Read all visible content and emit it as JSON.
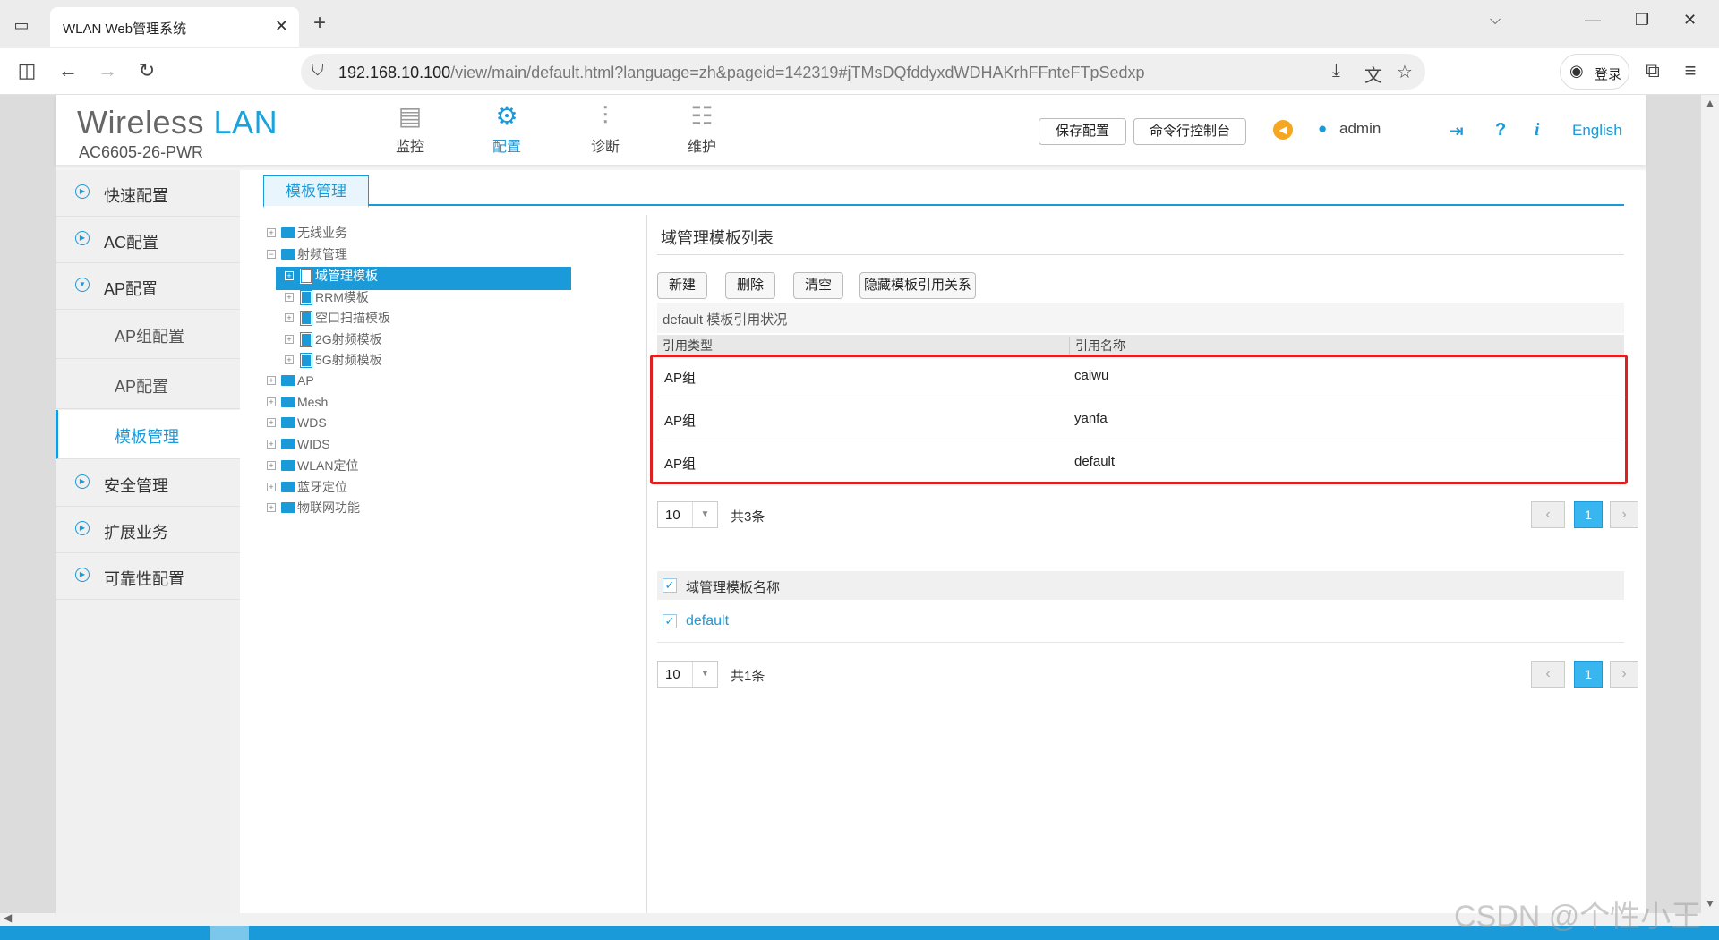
{
  "browser": {
    "tab_title": "WLAN Web管理系统",
    "tab_close": "✕",
    "new_tab": "+",
    "url_host": "192.168.10.100",
    "url_path": "/view/main/default.html?language=zh&pageid=142319#jTMsDQfddyxdWDHAKrhFFnteFTpSedxp",
    "login_label": "登录"
  },
  "header": {
    "brand_main": "Wireless",
    "brand_accent": "LAN",
    "model": "AC6605-26-PWR",
    "nav": [
      {
        "label": "监控",
        "icon": "monitor-icon"
      },
      {
        "label": "配置",
        "icon": "gear-icon"
      },
      {
        "label": "诊断",
        "icon": "sliders-icon"
      },
      {
        "label": "维护",
        "icon": "server-gear-icon"
      }
    ],
    "save_config": "保存配置",
    "cli_console": "命令行控制台",
    "username": "admin",
    "language": "English"
  },
  "sidebar": {
    "items": [
      {
        "label": "快速配置"
      },
      {
        "label": "AC配置"
      },
      {
        "label": "AP配置"
      },
      {
        "label": "AP组配置"
      },
      {
        "label": "AP配置"
      },
      {
        "label": "模板管理"
      },
      {
        "label": "安全管理"
      },
      {
        "label": "扩展业务"
      },
      {
        "label": "可靠性配置"
      }
    ]
  },
  "content": {
    "tab_label": "模板管理",
    "tree": [
      {
        "label": "无线业务"
      },
      {
        "label": "射频管理"
      },
      {
        "label": "域管理模板"
      },
      {
        "label": "RRM模板"
      },
      {
        "label": "空口扫描模板"
      },
      {
        "label": "2G射频模板"
      },
      {
        "label": "5G射频模板"
      },
      {
        "label": "AP"
      },
      {
        "label": "Mesh"
      },
      {
        "label": "WDS"
      },
      {
        "label": "WIDS"
      },
      {
        "label": "WLAN定位"
      },
      {
        "label": "蓝牙定位"
      },
      {
        "label": "物联网功能"
      }
    ],
    "panel_title": "域管理模板列表",
    "buttons": {
      "new": "新建",
      "delete": "删除",
      "clear": "清空",
      "hide_refs": "隐藏模板引用关系"
    },
    "ref_caption": "default 模板引用状况",
    "ref_columns": [
      "引用类型",
      "引用名称"
    ],
    "ref_rows": [
      {
        "type": "AP组",
        "name": "caiwu"
      },
      {
        "type": "AP组",
        "name": "yanfa"
      },
      {
        "type": "AP组",
        "name": "default"
      }
    ],
    "pager1": {
      "size": "10",
      "total": "共3条",
      "page": "1"
    },
    "list_header": "域管理模板名称",
    "list_rows": [
      {
        "name": "default"
      }
    ],
    "pager2": {
      "size": "10",
      "total": "共1条",
      "page": "1"
    }
  },
  "watermark": "CSDN @个性小王",
  "colors": {
    "accent": "#1a9ad8",
    "highlight": "#e02020"
  }
}
